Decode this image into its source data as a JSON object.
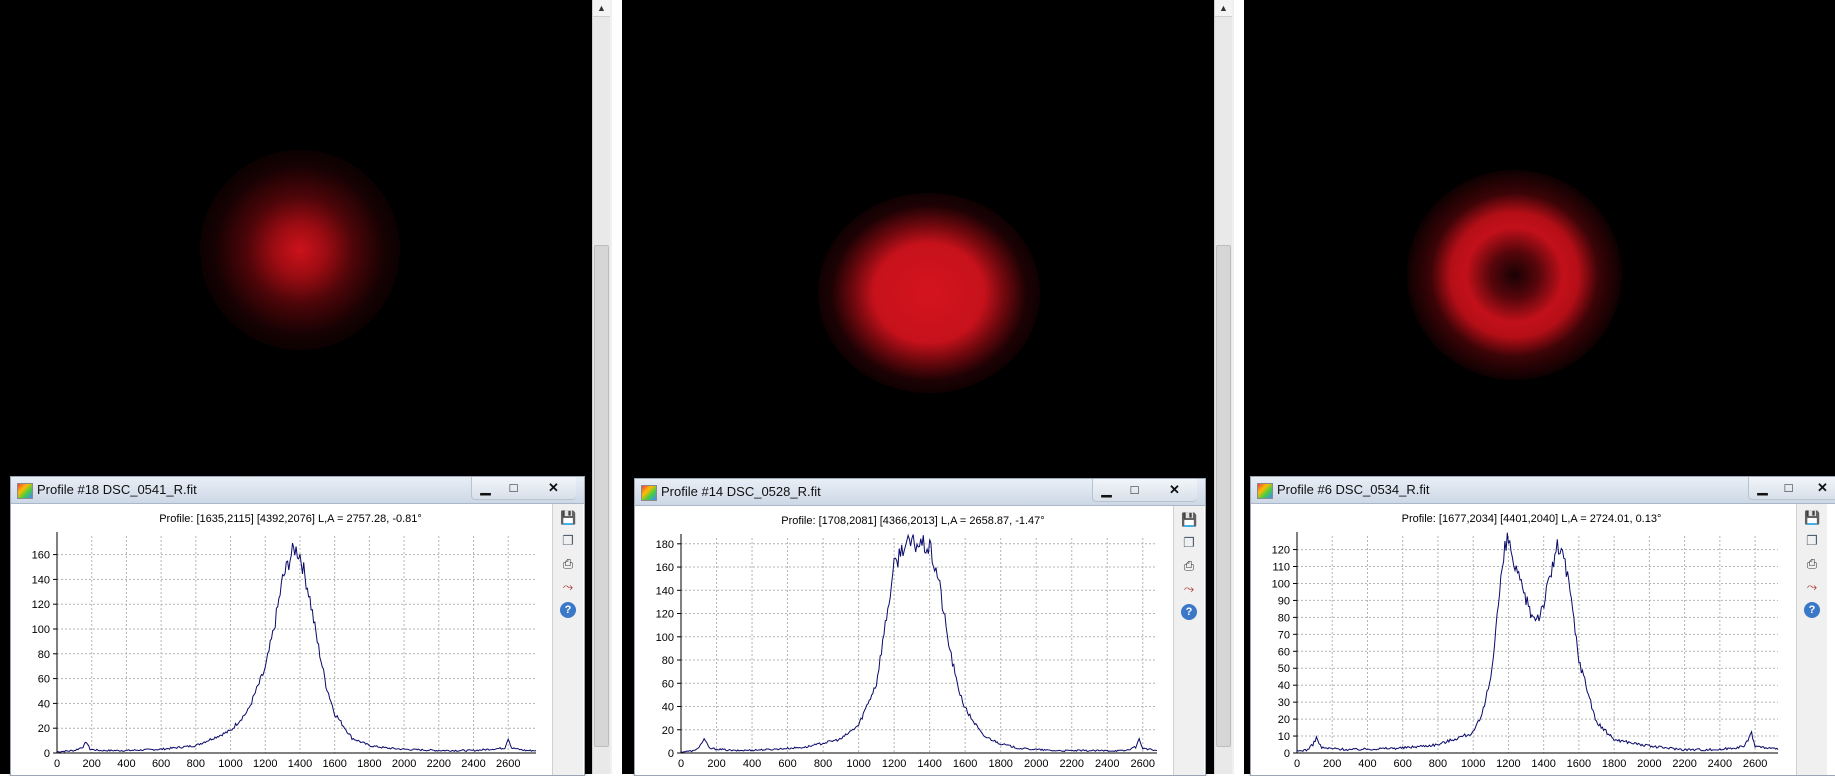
{
  "colors": {
    "curve": "#0a0a6a",
    "spot": "#c8101a",
    "grid": "#b4b4b4"
  },
  "windows": [
    {
      "image": {
        "pattern": "gaussian-spot"
      },
      "profile": {
        "title": "Profile #18 DSC_0541_R.fit",
        "header": "Profile: [1635,2115] [4392,2076]  L,A = 2757.28, -0.81°",
        "controls": {
          "minimize": "▁",
          "maximize": "□",
          "close": "✕"
        },
        "toolbar": [
          "save-icon",
          "copy-icon",
          "print-icon",
          "chart-settings-icon",
          "help-icon"
        ],
        "chart_data": {
          "type": "line",
          "xlim": [
            0,
            2760
          ],
          "ylim": [
            0,
            175
          ],
          "xticks": [
            0,
            200,
            400,
            600,
            800,
            1000,
            1200,
            1400,
            1600,
            1800,
            2000,
            2200,
            2400,
            2600
          ],
          "yticks": [
            0,
            20,
            40,
            60,
            80,
            100,
            120,
            140,
            160
          ],
          "x": [
            0,
            100,
            150,
            170,
            190,
            250,
            400,
            600,
            800,
            1000,
            1100,
            1200,
            1250,
            1300,
            1350,
            1370,
            1400,
            1450,
            1500,
            1550,
            1600,
            1700,
            1800,
            1900,
            2000,
            2200,
            2400,
            2580,
            2600,
            2620,
            2700,
            2760
          ],
          "y": [
            1,
            2,
            5,
            9,
            3,
            2,
            2,
            3,
            6,
            18,
            34,
            68,
            100,
            140,
            160,
            165,
            160,
            130,
            90,
            55,
            32,
            12,
            6,
            4,
            3,
            2,
            2,
            4,
            12,
            4,
            2,
            2
          ]
        }
      }
    },
    {
      "image": {
        "pattern": "flat-top-spot"
      },
      "profile": {
        "title": "Profile #14 DSC_0528_R.fit",
        "header": "Profile: [1708,2081] [4366,2013]  L,A = 2658.87, -1.47°",
        "controls": {
          "minimize": "▁",
          "maximize": "□",
          "close": "✕"
        },
        "toolbar": [
          "save-icon",
          "copy-icon",
          "print-icon",
          "chart-settings-icon",
          "help-icon"
        ],
        "chart_data": {
          "type": "line",
          "xlim": [
            0,
            2680
          ],
          "ylim": [
            0,
            185
          ],
          "xticks": [
            0,
            200,
            400,
            600,
            800,
            1000,
            1200,
            1400,
            1600,
            1800,
            2000,
            2200,
            2400,
            2600
          ],
          "yticks": [
            0,
            20,
            40,
            60,
            80,
            100,
            120,
            140,
            160,
            180
          ],
          "x": [
            0,
            80,
            110,
            130,
            160,
            300,
            500,
            700,
            900,
            1000,
            1100,
            1150,
            1200,
            1250,
            1300,
            1350,
            1400,
            1450,
            1500,
            1550,
            1600,
            1700,
            1800,
            1900,
            2100,
            2300,
            2500,
            2560,
            2580,
            2600,
            2680
          ],
          "y": [
            1,
            2,
            7,
            12,
            4,
            2,
            3,
            5,
            12,
            24,
            60,
            110,
            160,
            178,
            180,
            180,
            176,
            150,
            100,
            62,
            38,
            15,
            8,
            4,
            2,
            2,
            2,
            5,
            12,
            4,
            2
          ]
        }
      }
    },
    {
      "image": {
        "pattern": "donut-ring"
      },
      "profile": {
        "title": "Profile #6 DSC_0534_R.fit",
        "header": "Profile: [1677,2034] [4401,2040]  L,A = 2724.01, 0.13°",
        "controls": {
          "minimize": "▁",
          "maximize": "□",
          "close": "✕"
        },
        "toolbar": [
          "save-icon",
          "copy-icon",
          "print-icon",
          "chart-settings-icon",
          "help-icon"
        ],
        "chart_data": {
          "type": "line",
          "xlim": [
            0,
            2730
          ],
          "ylim": [
            0,
            128
          ],
          "xticks": [
            0,
            200,
            400,
            600,
            800,
            1000,
            1200,
            1400,
            1600,
            1800,
            2000,
            2200,
            2400,
            2600
          ],
          "yticks": [
            0,
            10,
            20,
            30,
            40,
            50,
            60,
            70,
            80,
            90,
            100,
            110,
            120
          ],
          "x": [
            0,
            60,
            90,
            110,
            140,
            300,
            600,
            800,
            1000,
            1050,
            1100,
            1150,
            1180,
            1200,
            1230,
            1280,
            1340,
            1380,
            1430,
            1470,
            1500,
            1550,
            1600,
            1700,
            1800,
            2000,
            2200,
            2400,
            2540,
            2580,
            2600,
            2730
          ],
          "y": [
            1,
            2,
            5,
            9,
            3,
            2,
            3,
            5,
            12,
            22,
            45,
            95,
            120,
            126,
            112,
            95,
            80,
            82,
            100,
            120,
            122,
            95,
            55,
            18,
            8,
            4,
            2,
            2,
            4,
            12,
            4,
            2
          ]
        }
      }
    }
  ]
}
